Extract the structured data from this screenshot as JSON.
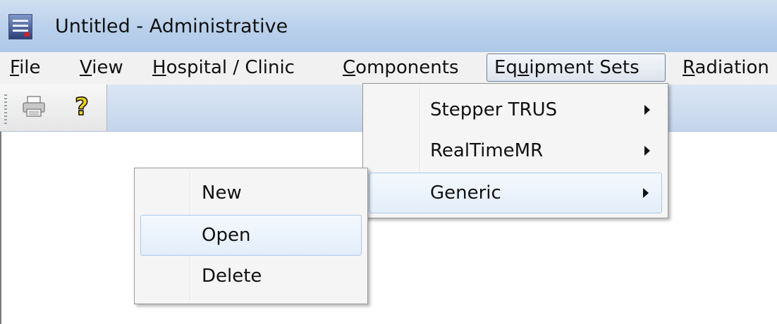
{
  "window": {
    "title": "Untitled - Administrative"
  },
  "menubar": {
    "items": [
      {
        "mnemonic": "F",
        "rest": "ile"
      },
      {
        "mnemonic": "V",
        "rest": "iew"
      },
      {
        "mnemonic": "H",
        "rest": "ospital / Clinic"
      },
      {
        "mnemonic": "C",
        "rest": "omponents"
      },
      {
        "pre": "Eq",
        "mnemonic": "u",
        "rest": "ipment Sets"
      },
      {
        "mnemonic": "R",
        "rest": "adiation"
      }
    ],
    "active": "Equipment Sets"
  },
  "toolbar": {
    "buttons": [
      {
        "icon": "printer-icon"
      },
      {
        "icon": "help-icon",
        "glyph": "?"
      }
    ]
  },
  "equipment_menu": {
    "items": [
      {
        "label": "Stepper TRUS",
        "has_submenu": true
      },
      {
        "label": "RealTimeMR",
        "has_submenu": true
      },
      {
        "label": "Generic",
        "has_submenu": true,
        "highlighted": true
      }
    ]
  },
  "generic_submenu": {
    "items": [
      {
        "label": "New"
      },
      {
        "label": "Open",
        "highlighted": true
      },
      {
        "label": "Delete"
      }
    ]
  },
  "colors": {
    "titlebar": "#b9d0ec",
    "menubar": "#f1f1f1",
    "highlight_border": "#aac8ea"
  }
}
